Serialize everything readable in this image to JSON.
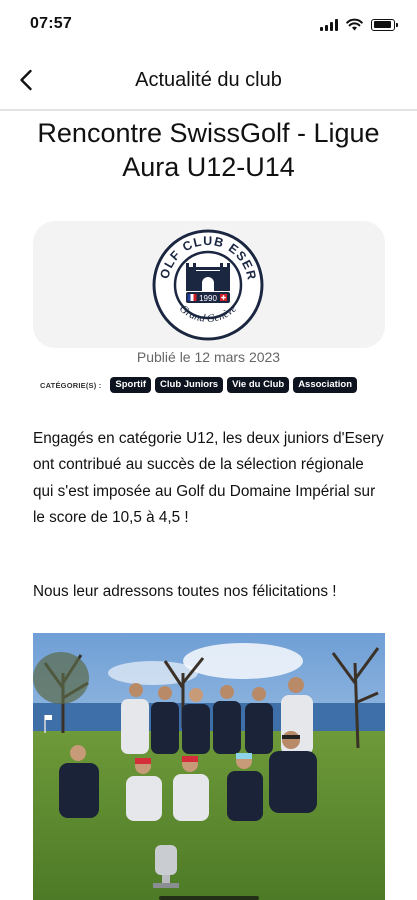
{
  "status_bar": {
    "time": "07:57"
  },
  "nav": {
    "title": "Actualité du club",
    "back_icon": "chevron-left-icon"
  },
  "article": {
    "title": "Rencontre SwissGolf - Ligue Aura U12-U14",
    "published": "Publié le 12 mars 2023",
    "categories_label": "CATÉGORIE(S) :",
    "categories": [
      "Sportif",
      "Club Juniors",
      "Vie du Club",
      "Association"
    ],
    "paragraph1": "Engagés en catégorie U12, les deux juniors d'Esery ont contribué au succès de la sélection régionale qui s'est imposée au Golf du Domaine Impérial sur le score de 10,5 à 4,5 !",
    "paragraph2": "Nous leur adressons toutes nos félicitations !"
  },
  "logo": {
    "top_text": "GOLF CLUB ESERY",
    "year": "1990",
    "bottom_text": "Grand Genève"
  },
  "colors": {
    "tag_bg": "#0d1420",
    "logo_navy": "#1b2740",
    "divider": "#e2e2e2"
  }
}
